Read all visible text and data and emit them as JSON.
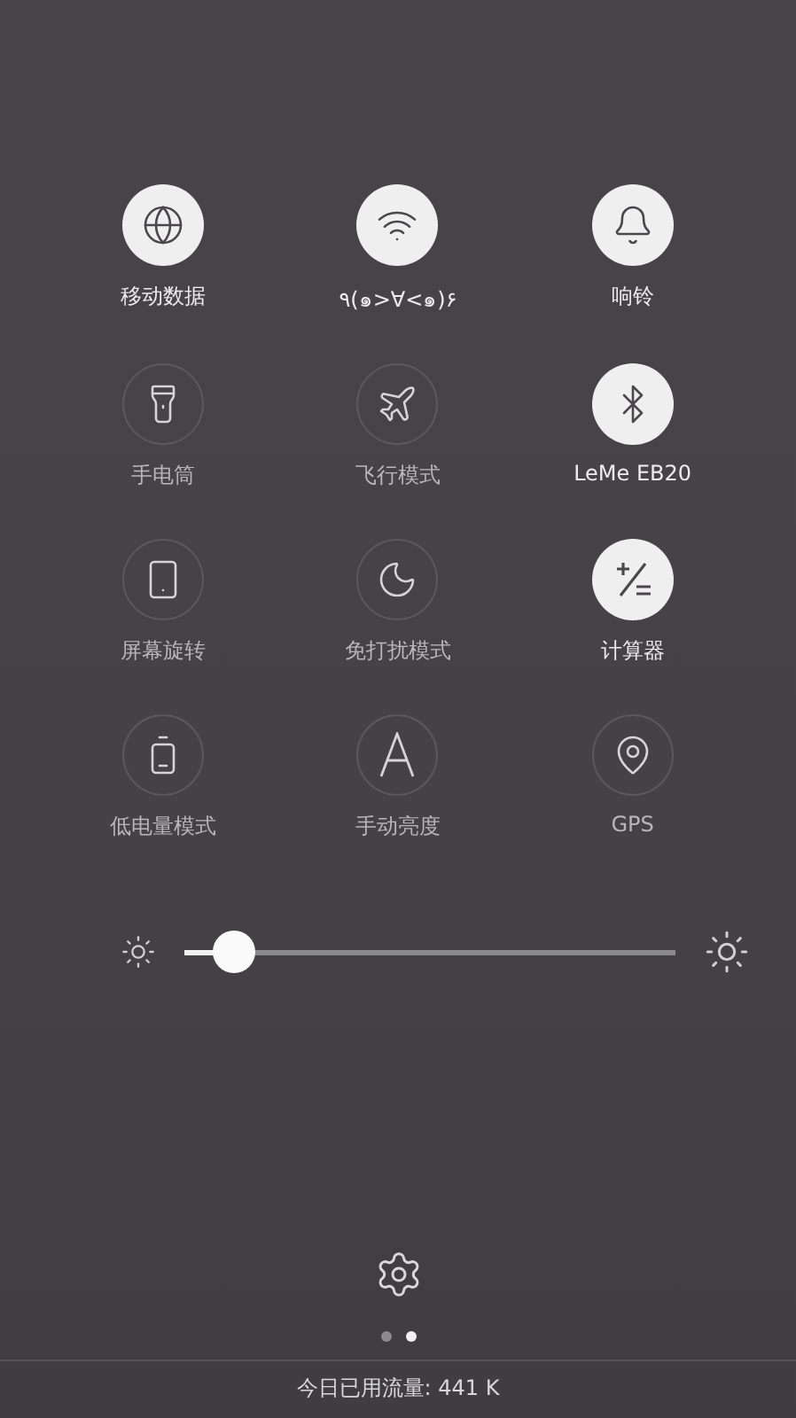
{
  "toggles": [
    {
      "label": "移动数据",
      "on": true
    },
    {
      "label": "٩(๑>∀<๑)۶",
      "on": true
    },
    {
      "label": "响铃",
      "on": true
    },
    {
      "label": "手电筒",
      "on": false
    },
    {
      "label": "飞行模式",
      "on": false
    },
    {
      "label": "LeMe EB20",
      "on": true
    },
    {
      "label": "屏幕旋转",
      "on": false
    },
    {
      "label": "免打扰模式",
      "on": false
    },
    {
      "label": "计算器",
      "on": true
    },
    {
      "label": "低电量模式",
      "on": false
    },
    {
      "label": "手动亮度",
      "on": false
    },
    {
      "label": "GPS",
      "on": false
    }
  ],
  "brightness": {
    "level": 0.1
  },
  "pages": [
    {
      "selected": false
    },
    {
      "selected": true
    }
  ],
  "footer": "今日已用流量: 441 K"
}
